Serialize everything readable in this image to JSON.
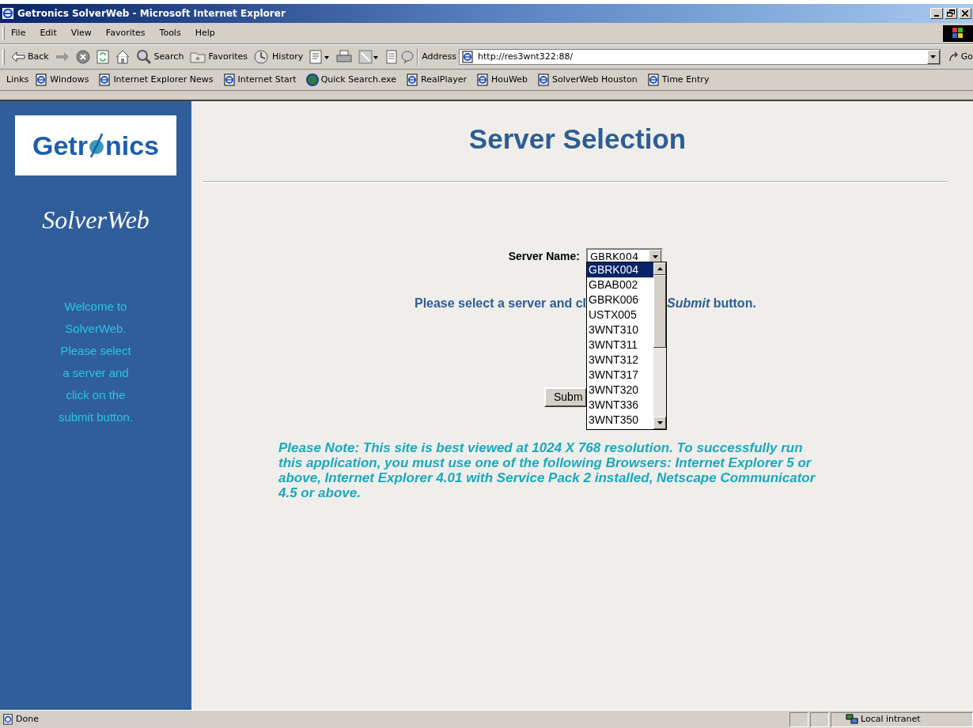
{
  "window": {
    "title": "Getronics SolverWeb - Microsoft Internet Explorer"
  },
  "menu": [
    "File",
    "Edit",
    "View",
    "Favorites",
    "Tools",
    "Help"
  ],
  "toolbar": [
    {
      "kind": "back",
      "label": "Back"
    },
    {
      "kind": "forward"
    },
    {
      "kind": "stop"
    },
    {
      "kind": "refresh"
    },
    {
      "kind": "home"
    },
    {
      "kind": "search",
      "label": "Search"
    },
    {
      "kind": "favorites",
      "label": "Favorites"
    },
    {
      "kind": "history",
      "label": "History"
    },
    {
      "kind": "mail"
    },
    {
      "kind": "print"
    },
    {
      "kind": "edit"
    },
    {
      "kind": "discuss"
    }
  ],
  "address": {
    "label": "Address",
    "value": "http://res3wnt322:88/",
    "go": "Go"
  },
  "links": {
    "label": "Links",
    "items": [
      {
        "label": "Windows",
        "kind": "page"
      },
      {
        "label": "Internet Explorer News",
        "kind": "page"
      },
      {
        "label": "Internet Start",
        "kind": "page"
      },
      {
        "label": "Quick Search.exe",
        "kind": "globe"
      },
      {
        "label": "RealPlayer",
        "kind": "page"
      },
      {
        "label": "HouWeb",
        "kind": "page"
      },
      {
        "label": "SolverWeb Houston",
        "kind": "page"
      },
      {
        "label": "Time Entry",
        "kind": "page"
      }
    ]
  },
  "sidebar": {
    "logo_left": "Getr",
    "logo_right": "nics",
    "product": "SolverWeb",
    "welcome": "Welcome to\nSolverWeb.\nPlease select\na server and\nclick on the\nsubmit button."
  },
  "main": {
    "title": "Server Selection",
    "server_label": "Server Name:",
    "server_value": "GBRK004",
    "options": [
      {
        "label": "GBRK004",
        "selected": true
      },
      {
        "label": "GBAB002",
        "selected": false
      },
      {
        "label": "GBRK006",
        "selected": false
      },
      {
        "label": "USTX005",
        "selected": false
      },
      {
        "label": "3WNT310",
        "selected": false
      },
      {
        "label": "3WNT311",
        "selected": false
      },
      {
        "label": "3WNT312",
        "selected": false
      },
      {
        "label": "3WNT317",
        "selected": false
      },
      {
        "label": "3WNT320",
        "selected": false
      },
      {
        "label": "3WNT336",
        "selected": false
      },
      {
        "label": "3WNT350",
        "selected": false
      }
    ],
    "instruction_left": "Please select a server and cl",
    "instruction_right": "*Submit* button.",
    "submit": "Subm",
    "note": "Please Note: This site is best viewed at 1024 X 768 resolution. To successfully run this application, you must use one of the following Browsers: Internet Explorer 5 or above, Internet Explorer 4.01 with Service Pack 2 installed, Netscape Communicator 4.5 or above."
  },
  "status_bar": {
    "text": "Done",
    "zone": "Local intranet"
  }
}
